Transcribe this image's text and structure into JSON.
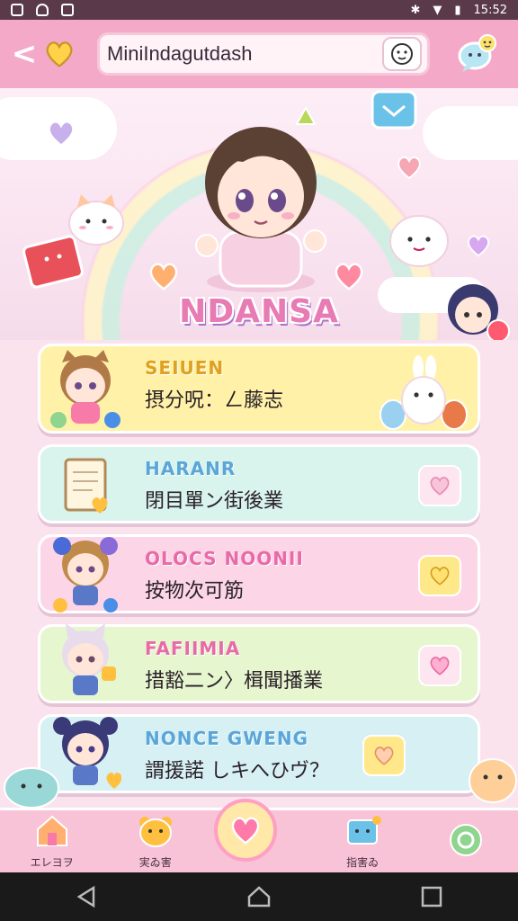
{
  "status_bar": {
    "time": "15:52"
  },
  "header": {
    "search_text": "MiniIndagutdash",
    "back_label": "<"
  },
  "hero": {
    "title": "NDANSA"
  },
  "cards": [
    {
      "title": "SEIUEN",
      "subtitle": "摂分呪：ㄥ藤志",
      "title_color": "#e0a020",
      "bg": "#fff2a8"
    },
    {
      "title": "HARANR",
      "subtitle": "閉目單ン街後業",
      "title_color": "#5aa6d8",
      "bg": "#d8f4ec"
    },
    {
      "title": "OLOCS NOONII",
      "subtitle": "按物次可筋",
      "title_color": "#e86aa8",
      "bg": "#fcd6e6"
    },
    {
      "title": "FAFIIMIA",
      "subtitle": "措豁二ン〉楫聞播業",
      "title_color": "#e86aa8",
      "bg": "#e6f6cf"
    },
    {
      "title": "NONCE GWENG",
      "subtitle": "謂援諾 しキへひヴ？",
      "title_color": "#5aa6d8",
      "bg": "#d6f0f4"
    }
  ],
  "bottom_nav": [
    {
      "label": "エレヨヲ"
    },
    {
      "label": "実ゐ害"
    },
    {
      "label": ""
    },
    {
      "label": "指害ゐ"
    },
    {
      "label": ""
    }
  ],
  "colors": {
    "accent": "#f5a9c8",
    "nav": "#f8c3d7"
  }
}
